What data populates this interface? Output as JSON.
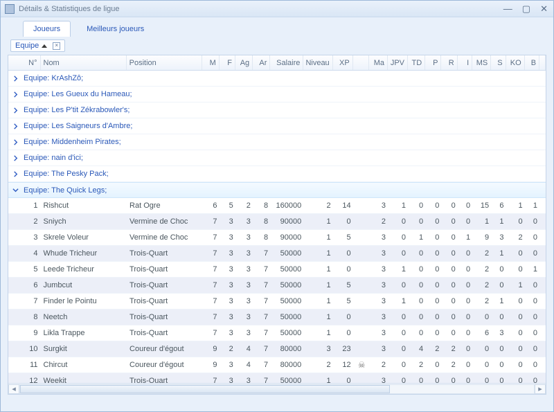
{
  "window": {
    "title": "Détails & Statistiques de ligue"
  },
  "tabs": [
    {
      "label": "Joueurs",
      "active": true
    },
    {
      "label": "Meilleurs joueurs",
      "active": false
    }
  ],
  "group_chip": {
    "label": "Equipe",
    "sort": "asc"
  },
  "columns": {
    "num": "N°",
    "nom": "Nom",
    "pos": "Position",
    "m": "M",
    "f": "F",
    "ag": "Ag",
    "ar": "Ar",
    "sal": "Salaire",
    "niv": "Niveau",
    "xp": "XP",
    "ico": "",
    "ma": "Ma",
    "jpv": "JPV",
    "td": "TD",
    "p": "P",
    "r": "R",
    "i": "I",
    "ms": "MS",
    "s": "S",
    "ko": "KO",
    "b": "B"
  },
  "groups": [
    {
      "label": "Equipe: KrAshZô;",
      "expanded": false,
      "rows": []
    },
    {
      "label": "Equipe: Les Gueux du Hameau;",
      "expanded": false,
      "rows": []
    },
    {
      "label": "Equipe: Les P'tit Zékrabowler's;",
      "expanded": false,
      "rows": []
    },
    {
      "label": "Equipe: Les Saigneurs d'Ambre;",
      "expanded": false,
      "rows": []
    },
    {
      "label": "Equipe: Middenheim Pirates;",
      "expanded": false,
      "rows": []
    },
    {
      "label": "Equipe: nain d'ici;",
      "expanded": false,
      "rows": []
    },
    {
      "label": "Equipe: The Pesky Pack;",
      "expanded": false,
      "rows": []
    },
    {
      "label": "Equipe: The Quick Legs;",
      "expanded": true,
      "rows": [
        {
          "num": 1,
          "nom": "Rishcut",
          "pos": "Rat Ogre",
          "m": 6,
          "f": 5,
          "ag": 2,
          "ar": 8,
          "sal": 160000,
          "niv": 2,
          "xp": 14,
          "ico": "",
          "ma": 3,
          "jpv": 1,
          "td": 0,
          "p": 0,
          "r": 0,
          "i": 0,
          "ms": 15,
          "s": 6,
          "ko": 1,
          "b": 1
        },
        {
          "num": 2,
          "nom": "Sniych",
          "pos": "Vermine de Choc",
          "m": 7,
          "f": 3,
          "ag": 3,
          "ar": 8,
          "sal": 90000,
          "niv": 1,
          "xp": 0,
          "ico": "",
          "ma": 2,
          "jpv": 0,
          "td": 0,
          "p": 0,
          "r": 0,
          "i": 0,
          "ms": 1,
          "s": 1,
          "ko": 0,
          "b": 0
        },
        {
          "num": 3,
          "nom": "Skrele Voleur",
          "pos": "Vermine de Choc",
          "m": 7,
          "f": 3,
          "ag": 3,
          "ar": 8,
          "sal": 90000,
          "niv": 1,
          "xp": 5,
          "ico": "",
          "ma": 3,
          "jpv": 0,
          "td": 1,
          "p": 0,
          "r": 0,
          "i": 1,
          "ms": 9,
          "s": 3,
          "ko": 2,
          "b": 0
        },
        {
          "num": 4,
          "nom": "Whude Tricheur",
          "pos": "Trois-Quart",
          "m": 7,
          "f": 3,
          "ag": 3,
          "ar": 7,
          "sal": 50000,
          "niv": 1,
          "xp": 0,
          "ico": "",
          "ma": 3,
          "jpv": 0,
          "td": 0,
          "p": 0,
          "r": 0,
          "i": 0,
          "ms": 2,
          "s": 1,
          "ko": 0,
          "b": 0
        },
        {
          "num": 5,
          "nom": "Leede Tricheur",
          "pos": "Trois-Quart",
          "m": 7,
          "f": 3,
          "ag": 3,
          "ar": 7,
          "sal": 50000,
          "niv": 1,
          "xp": 0,
          "ico": "",
          "ma": 3,
          "jpv": 1,
          "td": 0,
          "p": 0,
          "r": 0,
          "i": 0,
          "ms": 2,
          "s": 0,
          "ko": 0,
          "b": 1
        },
        {
          "num": 6,
          "nom": "Jumbcut",
          "pos": "Trois-Quart",
          "m": 7,
          "f": 3,
          "ag": 3,
          "ar": 7,
          "sal": 50000,
          "niv": 1,
          "xp": 5,
          "ico": "",
          "ma": 3,
          "jpv": 0,
          "td": 0,
          "p": 0,
          "r": 0,
          "i": 0,
          "ms": 2,
          "s": 0,
          "ko": 1,
          "b": 0
        },
        {
          "num": 7,
          "nom": "Finder le Pointu",
          "pos": "Trois-Quart",
          "m": 7,
          "f": 3,
          "ag": 3,
          "ar": 7,
          "sal": 50000,
          "niv": 1,
          "xp": 5,
          "ico": "",
          "ma": 3,
          "jpv": 1,
          "td": 0,
          "p": 0,
          "r": 0,
          "i": 0,
          "ms": 2,
          "s": 1,
          "ko": 0,
          "b": 0
        },
        {
          "num": 8,
          "nom": "Neetch",
          "pos": "Trois-Quart",
          "m": 7,
          "f": 3,
          "ag": 3,
          "ar": 7,
          "sal": 50000,
          "niv": 1,
          "xp": 0,
          "ico": "",
          "ma": 3,
          "jpv": 0,
          "td": 0,
          "p": 0,
          "r": 0,
          "i": 0,
          "ms": 0,
          "s": 0,
          "ko": 0,
          "b": 0
        },
        {
          "num": 9,
          "nom": "Likla Trappe",
          "pos": "Trois-Quart",
          "m": 7,
          "f": 3,
          "ag": 3,
          "ar": 7,
          "sal": 50000,
          "niv": 1,
          "xp": 0,
          "ico": "",
          "ma": 3,
          "jpv": 0,
          "td": 0,
          "p": 0,
          "r": 0,
          "i": 0,
          "ms": 6,
          "s": 3,
          "ko": 0,
          "b": 0
        },
        {
          "num": 10,
          "nom": "Surgkit",
          "pos": "Coureur d'égout",
          "m": 9,
          "f": 2,
          "ag": 4,
          "ar": 7,
          "sal": 80000,
          "niv": 3,
          "xp": 23,
          "ico": "",
          "ma": 3,
          "jpv": 0,
          "td": 4,
          "p": 2,
          "r": 2,
          "i": 0,
          "ms": 0,
          "s": 0,
          "ko": 0,
          "b": 0
        },
        {
          "num": 11,
          "nom": "Chircut",
          "pos": "Coureur d'égout",
          "m": 9,
          "f": 3,
          "ag": 4,
          "ar": 7,
          "sal": 80000,
          "niv": 2,
          "xp": 12,
          "ico": "skull",
          "ma": 2,
          "jpv": 0,
          "td": 2,
          "p": 0,
          "r": 2,
          "i": 0,
          "ms": 0,
          "s": 0,
          "ko": 0,
          "b": 0
        },
        {
          "num": 12,
          "nom": "Weekit",
          "pos": "Trois-Quart",
          "m": 7,
          "f": 3,
          "ag": 3,
          "ar": 7,
          "sal": 50000,
          "niv": 1,
          "xp": 0,
          "ico": "",
          "ma": 3,
          "jpv": 0,
          "td": 0,
          "p": 0,
          "r": 0,
          "i": 0,
          "ms": 0,
          "s": 0,
          "ko": 0,
          "b": 0
        }
      ]
    }
  ]
}
